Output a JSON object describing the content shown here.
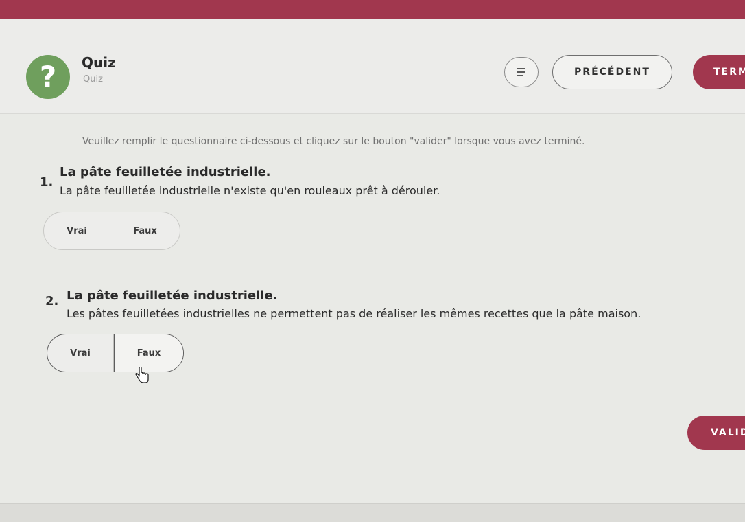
{
  "header": {
    "icon_glyph": "?",
    "title": "Quiz",
    "subtitle": "Quiz",
    "prev_label": "PRÉCÉDENT",
    "finish_label": "TERM",
    "accent_color": "#a1374e",
    "icon_color": "#6f9f5d",
    "menu_icon": "list-icon"
  },
  "instruction": "Veuillez remplir le questionnaire ci-dessous et cliquez sur le bouton \"valider\" lorsque vous avez terminé.",
  "questions": [
    {
      "number": "1.",
      "title": "La pâte feuilletée industrielle.",
      "text": "La pâte feuilletée industrielle n'existe qu'en rouleaux prêt à dérouler.",
      "options": [
        "Vrai",
        "Faux"
      ],
      "selected": null
    },
    {
      "number": "2.",
      "title": "La pâte feuilletée industrielle.",
      "text": "Les pâtes feuilletées industrielles ne permettent pas de réaliser les mêmes recettes que la pâte maison.",
      "options": [
        "Vrai",
        "Faux"
      ],
      "selected": "Faux"
    }
  ],
  "submit_label": "VALIDER"
}
